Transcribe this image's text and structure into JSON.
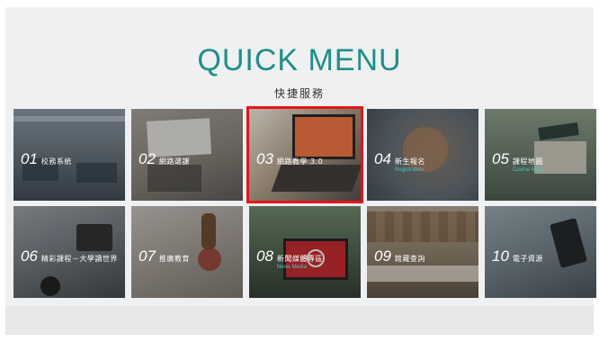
{
  "header": {
    "title": "QUICK MENU",
    "subtitle": "快捷服務"
  },
  "tiles": [
    {
      "num": "01",
      "cn": "校務系統",
      "en": "",
      "icon": "office-photo",
      "selected": false
    },
    {
      "num": "02",
      "cn": "網路選課",
      "en": "",
      "icon": "calendar-photo",
      "selected": false
    },
    {
      "num": "03",
      "cn": "網路教學 3.0",
      "en": "",
      "icon": "e-learning-photo",
      "selected": true
    },
    {
      "num": "04",
      "cn": "新生報名",
      "en": "Registration",
      "icon": "hands-photo",
      "selected": false
    },
    {
      "num": "05",
      "cn": "課程地圖",
      "en": "Course Map",
      "icon": "graduation-photo",
      "selected": false
    },
    {
      "num": "06",
      "cn": "精彩課程－大學讀世界",
      "en": "",
      "icon": "tablet-photo",
      "selected": false
    },
    {
      "num": "07",
      "cn": "推廣教育",
      "en": "",
      "icon": "seal-photo",
      "selected": false
    },
    {
      "num": "08",
      "cn": "新聞媒體專區",
      "en": "News Media",
      "icon": "laptop-video-photo",
      "selected": false
    },
    {
      "num": "09",
      "cn": "館藏查詢",
      "en": "",
      "icon": "books-photo",
      "selected": false
    },
    {
      "num": "10",
      "cn": "電子資源",
      "en": "",
      "icon": "ereader-photo",
      "selected": false
    }
  ],
  "colors": {
    "accent": "#1f8f86",
    "highlight": "#e8131a",
    "en_text": "#48c7b9"
  }
}
